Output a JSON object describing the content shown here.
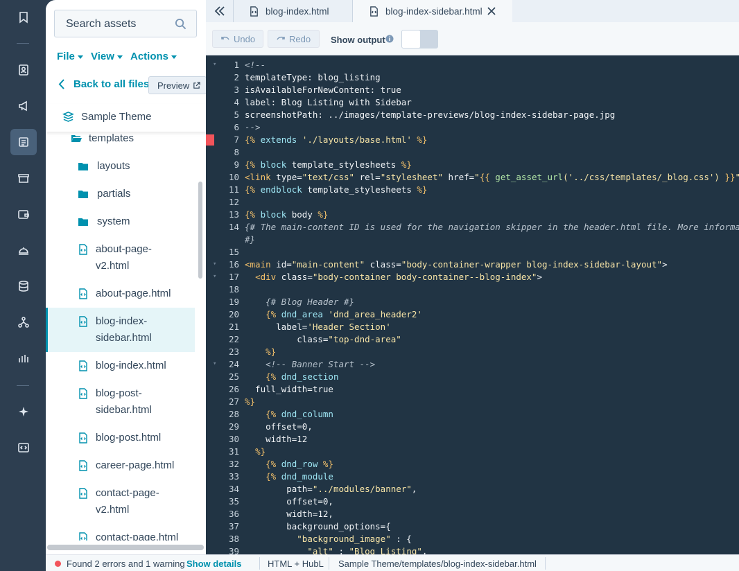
{
  "sidebar": {
    "search": {
      "placeholder": "Search assets"
    },
    "menus": {
      "file": "File",
      "view": "View",
      "actions": "Actions"
    },
    "back_label": "Back to all files",
    "preview_label": "Preview",
    "theme_name": "Sample Theme",
    "tree": [
      {
        "label": "templates",
        "type": "folder-open"
      },
      {
        "label": "layouts",
        "type": "folder"
      },
      {
        "label": "partials",
        "type": "folder"
      },
      {
        "label": "system",
        "type": "folder"
      },
      {
        "label": "about-page-",
        "label2": "v2.html",
        "type": "file"
      },
      {
        "label": "about-page.html",
        "type": "file"
      },
      {
        "label": "blog-index-",
        "label2": "sidebar.html",
        "type": "file",
        "selected": true
      },
      {
        "label": "blog-index.html",
        "type": "file"
      },
      {
        "label": "blog-post-",
        "label2": "sidebar.html",
        "type": "file"
      },
      {
        "label": "blog-post.html",
        "type": "file"
      },
      {
        "label": "career-page.html",
        "type": "file"
      },
      {
        "label": "contact-page-",
        "label2": "v2.html",
        "type": "file"
      },
      {
        "label": "contact-page.html",
        "type": "file"
      }
    ]
  },
  "tabs": [
    {
      "label": "blog-index.html",
      "active": false
    },
    {
      "label": "blog-index-sidebar.html",
      "active": true
    }
  ],
  "toolbar": {
    "undo": "Undo",
    "redo": "Redo",
    "show_output": "Show output",
    "show_output_on": false
  },
  "editor": {
    "error_line": 7,
    "lines": [
      {
        "n": "1",
        "fold": true,
        "text": "<!--"
      },
      {
        "n": "2",
        "text": "templateType: blog_listing"
      },
      {
        "n": "3",
        "text": "isAvailableForNewContent: true"
      },
      {
        "n": "4",
        "text": "label: Blog Listing with Sidebar"
      },
      {
        "n": "5",
        "text": "screenshotPath: ../images/template-previews/blog-index-sidebar-page.jpg"
      },
      {
        "n": "6",
        "text": "-->"
      },
      {
        "n": "7",
        "text": "{% extends './layouts/base.html' %}"
      },
      {
        "n": "8",
        "text": ""
      },
      {
        "n": "9",
        "text": "{% block template_stylesheets %}"
      },
      {
        "n": "10",
        "text": "<link type=\"text/css\" rel=\"stylesheet\" href=\"{{ get_asset_url('../css/templates/_blog.css') }}\">"
      },
      {
        "n": "11",
        "text": "{% endblock template_stylesheets %}"
      },
      {
        "n": "12",
        "text": ""
      },
      {
        "n": "13",
        "text": "{% block body %}"
      },
      {
        "n": "14",
        "text": "{# The main-content ID is used for the navigation skipper in the header.html file. More information"
      },
      {
        "n": "",
        "text": "#}"
      },
      {
        "n": "15",
        "text": ""
      },
      {
        "n": "16",
        "fold": true,
        "text": "<main id=\"main-content\" class=\"body-container-wrapper blog-index-sidebar-layout\">"
      },
      {
        "n": "17",
        "fold": true,
        "text": "  <div class=\"body-container body-container--blog-index\">"
      },
      {
        "n": "18",
        "text": ""
      },
      {
        "n": "19",
        "text": "    {# Blog Header #}"
      },
      {
        "n": "20",
        "text": "    {% dnd_area 'dnd_area_header2'"
      },
      {
        "n": "21",
        "text": "      label='Header Section'"
      },
      {
        "n": "22",
        "text": "          class=\"top-dnd-area\""
      },
      {
        "n": "23",
        "text": "    %}"
      },
      {
        "n": "24",
        "fold": true,
        "text": "    <!-- Banner Start -->"
      },
      {
        "n": "25",
        "text": "    {% dnd_section"
      },
      {
        "n": "26",
        "text": "  full_width=true"
      },
      {
        "n": "27",
        "text": "%}"
      },
      {
        "n": "28",
        "text": "    {% dnd_column"
      },
      {
        "n": "29",
        "text": "    offset=0,"
      },
      {
        "n": "30",
        "text": "    width=12"
      },
      {
        "n": "31",
        "text": "  %}"
      },
      {
        "n": "32",
        "text": "    {% dnd_row %}"
      },
      {
        "n": "33",
        "text": "    {% dnd_module"
      },
      {
        "n": "34",
        "text": "        path=\"../modules/banner\","
      },
      {
        "n": "35",
        "text": "        offset=0,"
      },
      {
        "n": "36",
        "text": "        width=12,"
      },
      {
        "n": "37",
        "text": "        background_options={"
      },
      {
        "n": "38",
        "text": "          \"background_image\" : {"
      },
      {
        "n": "39",
        "text": "            \"alt\" : \"Blog Listing\","
      }
    ]
  },
  "status": {
    "message": "Found 2 errors and 1 warning",
    "details_link": "Show details",
    "language": "HTML + HubL",
    "path": "Sample Theme/templates/blog-index-sidebar.html"
  },
  "colors": {
    "accent": "#0091ae",
    "error": "#f2545b",
    "editor_bg": "#213444",
    "rail_bg": "#2d3e50"
  }
}
